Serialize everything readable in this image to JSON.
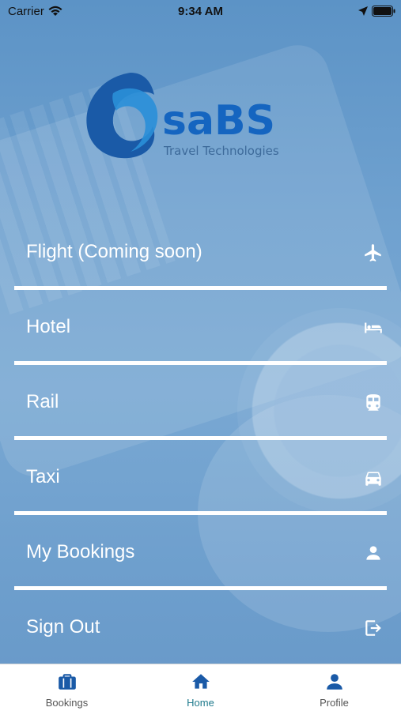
{
  "status_bar": {
    "carrier": "Carrier",
    "time": "9:34 AM"
  },
  "logo": {
    "brand": "saBS",
    "tagline": "Travel Technologies"
  },
  "menu": {
    "items": [
      {
        "label": "Flight (Coming soon)",
        "icon": "airplane-icon"
      },
      {
        "label": "Hotel",
        "icon": "bed-icon"
      },
      {
        "label": "Rail",
        "icon": "train-icon"
      },
      {
        "label": "Taxi",
        "icon": "car-icon"
      },
      {
        "label": "My Bookings",
        "icon": "person-icon"
      },
      {
        "label": "Sign Out",
        "icon": "sign-out-icon"
      }
    ]
  },
  "tabbar": {
    "tabs": [
      {
        "label": "Bookings",
        "icon": "briefcase-icon"
      },
      {
        "label": "Home",
        "icon": "home-icon",
        "active": true
      },
      {
        "label": "Profile",
        "icon": "person-icon"
      }
    ]
  },
  "colors": {
    "accent": "#1f7a8c",
    "icon_blue": "#1a5aa7",
    "logo_blue": "#1565c0"
  }
}
